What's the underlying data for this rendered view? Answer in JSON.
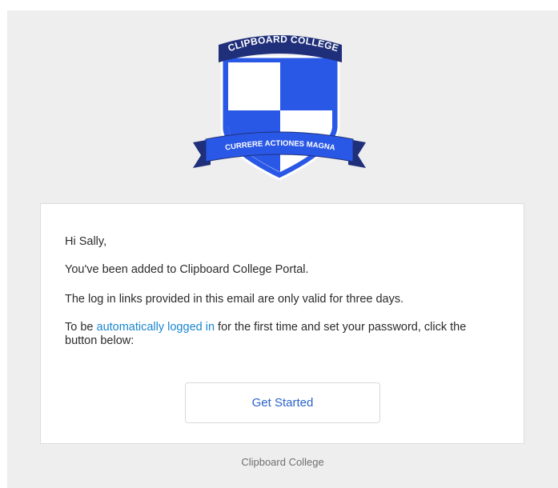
{
  "crest": {
    "top_banner_text": "CLIPBOARD COLLEGE",
    "ribbon_text": "CURRERE ACTIONES MAGNA",
    "colors": {
      "navy": "#1f2f7a",
      "blue": "#2a58e6",
      "white": "#ffffff"
    }
  },
  "email": {
    "greeting": "Hi Sally,",
    "line_added": "You've been added to Clipboard College Portal.",
    "line_validity": "The log in links provided in this email are only valid for three days.",
    "line_instruction_prefix": "To be ",
    "auto_login_link": "automatically logged in",
    "line_instruction_suffix": " for the first time and set your password, click the button below:",
    "button_label": "Get Started",
    "link_color": "#1a86d0",
    "button_text_color": "#2a63c9"
  },
  "footer": {
    "text": "Clipboard College"
  }
}
